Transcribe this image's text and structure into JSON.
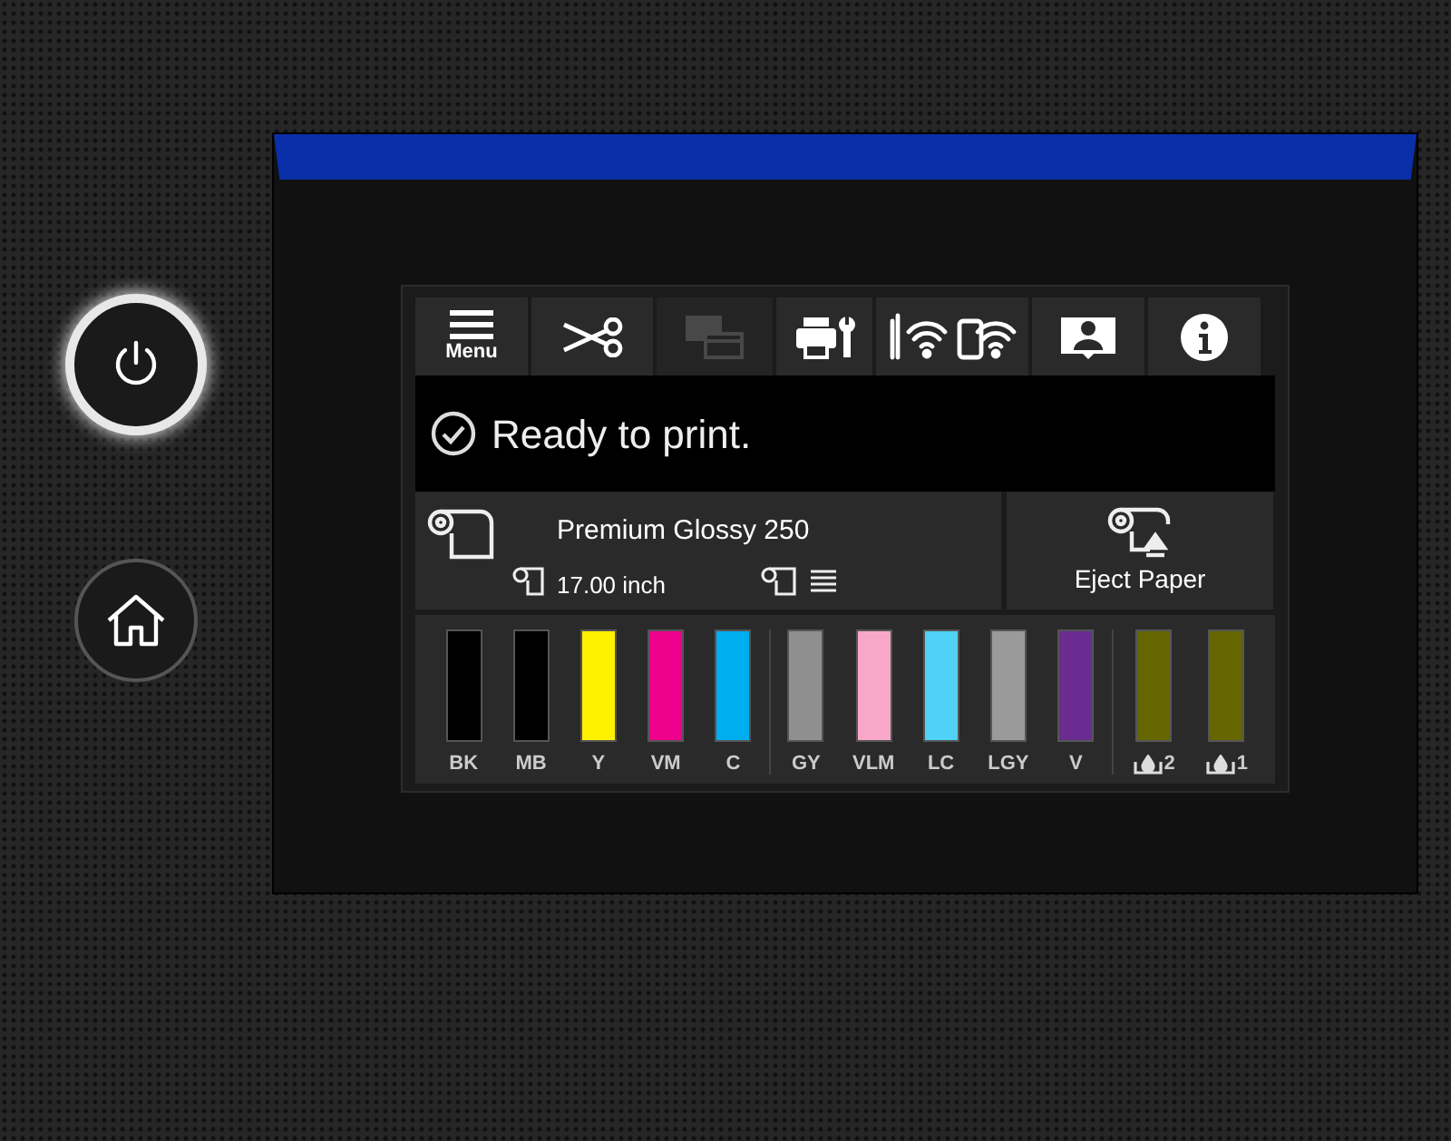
{
  "toolbar": [
    {
      "kind": "menu",
      "label": "Menu",
      "disabled": false
    },
    {
      "kind": "cut",
      "disabled": false
    },
    {
      "kind": "layers",
      "disabled": true
    },
    {
      "kind": "maintenance",
      "disabled": false
    },
    {
      "kind": "network",
      "disabled": false
    },
    {
      "kind": "guide",
      "disabled": false
    },
    {
      "kind": "info",
      "disabled": false
    }
  ],
  "status": {
    "text": "Ready to print."
  },
  "paper": {
    "name": "Premium Glossy 250",
    "width": "17.00 inch"
  },
  "eject": {
    "label": "Eject Paper"
  },
  "ink_groups": [
    [
      {
        "label": "BK",
        "color": "#000000",
        "level": 1
      },
      {
        "label": "MB",
        "color": "#000000",
        "level": 1
      },
      {
        "label": "Y",
        "color": "#fff200",
        "level": 1
      },
      {
        "label": "VM",
        "color": "#ec008c",
        "level": 1
      },
      {
        "label": "C",
        "color": "#00aeef",
        "level": 1
      }
    ],
    [
      {
        "label": "GY",
        "color": "#8f8f8f",
        "level": 1
      },
      {
        "label": "VLM",
        "color": "#f9a7c9",
        "level": 1
      },
      {
        "label": "LC",
        "color": "#4fd2f5",
        "level": 1
      },
      {
        "label": "LGY",
        "color": "#9a9a9a",
        "level": 1
      },
      {
        "label": "V",
        "color": "#6a2c91",
        "level": 1
      }
    ]
  ],
  "maintenance_boxes": [
    {
      "label": "2",
      "level": 1
    },
    {
      "label": "1",
      "level": 1
    }
  ]
}
